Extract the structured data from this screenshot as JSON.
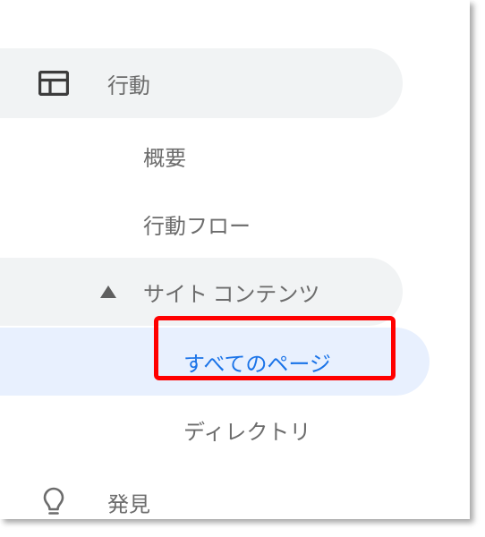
{
  "nav": {
    "behavior": {
      "label": "行動",
      "overview": "概要",
      "flow": "行動フロー",
      "site_content": {
        "label": "サイト コンテンツ",
        "all_pages": "すべてのページ",
        "directory": "ディレクトリ"
      }
    },
    "discover": "発見"
  }
}
